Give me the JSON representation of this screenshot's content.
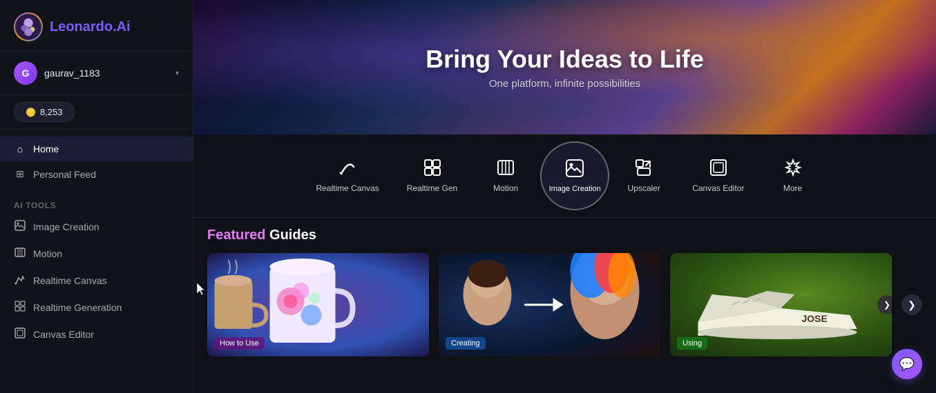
{
  "app": {
    "name": "Leonardo",
    "name_suffix": ".Ai"
  },
  "user": {
    "initial": "G",
    "username": "gaurav_1183",
    "tokens": "8,253"
  },
  "sidebar": {
    "home_label": "Home",
    "personal_feed_label": "Personal Feed",
    "ai_tools_heading": "AI Tools",
    "tools": [
      {
        "id": "image-creation",
        "label": "Image Creation"
      },
      {
        "id": "motion",
        "label": "Motion"
      },
      {
        "id": "realtime-canvas",
        "label": "Realtime Canvas"
      },
      {
        "id": "realtime-generation",
        "label": "Realtime Generation"
      },
      {
        "id": "canvas-editor",
        "label": "Canvas Editor"
      }
    ]
  },
  "hero": {
    "title": "Bring Your Ideas to Life",
    "subtitle": "One platform, infinite possibilities"
  },
  "tool_tabs": [
    {
      "id": "realtime-canvas",
      "label": "Realtime Canvas",
      "icon": "✏️"
    },
    {
      "id": "realtime-gen",
      "label": "Realtime Gen",
      "icon": "⊞"
    },
    {
      "id": "motion",
      "label": "Motion",
      "icon": "🎬"
    },
    {
      "id": "image-creation",
      "label": "Image Creation",
      "icon": "🖼",
      "active": true
    },
    {
      "id": "upscaler",
      "label": "Upscaler",
      "icon": "⤢"
    },
    {
      "id": "canvas-editor",
      "label": "Canvas Editor",
      "icon": "▣"
    },
    {
      "id": "more",
      "label": "More",
      "icon": "✦"
    }
  ],
  "featured": {
    "title_pink": "Featured",
    "title_rest": " Guides",
    "cards": [
      {
        "id": "card1",
        "tag": "How to Use"
      },
      {
        "id": "card2",
        "tag": "Creating"
      },
      {
        "id": "card3",
        "tag": "Using"
      }
    ]
  }
}
